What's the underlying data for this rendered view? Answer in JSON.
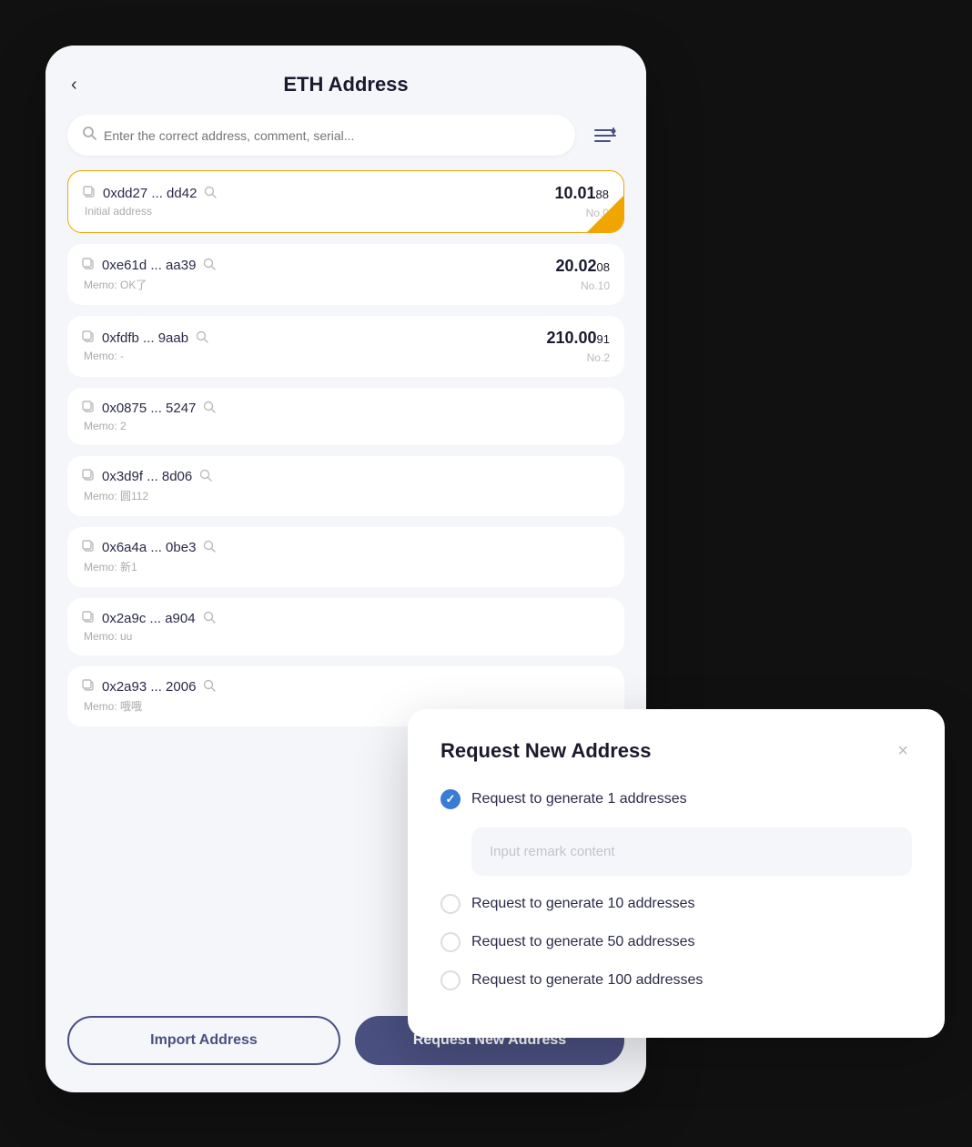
{
  "header": {
    "title": "ETH Address",
    "back_label": "‹"
  },
  "search": {
    "placeholder": "Enter the correct address, comment, serial..."
  },
  "addresses": [
    {
      "id": "addr-1",
      "address": "0xdd27 ... dd42",
      "memo": "Initial address",
      "balance_main": "10.01",
      "balance_decimal": "88",
      "no": "No.0",
      "active": true
    },
    {
      "id": "addr-2",
      "address": "0xe61d ... aa39",
      "memo": "Memo: OK了",
      "balance_main": "20.02",
      "balance_decimal": "08",
      "no": "No.10",
      "active": false
    },
    {
      "id": "addr-3",
      "address": "0xfdfb ... 9aab",
      "memo": "Memo: -",
      "balance_main": "210.00",
      "balance_decimal": "91",
      "no": "No.2",
      "active": false
    },
    {
      "id": "addr-4",
      "address": "0x0875 ... 5247",
      "memo": "Memo: 2",
      "balance_main": "",
      "balance_decimal": "",
      "no": "",
      "active": false
    },
    {
      "id": "addr-5",
      "address": "0x3d9f ... 8d06",
      "memo": "Memo: 圆112",
      "balance_main": "",
      "balance_decimal": "",
      "no": "",
      "active": false
    },
    {
      "id": "addr-6",
      "address": "0x6a4a ... 0be3",
      "memo": "Memo: 新1",
      "balance_main": "",
      "balance_decimal": "",
      "no": "",
      "active": false
    },
    {
      "id": "addr-7",
      "address": "0x2a9c ... a904",
      "memo": "Memo: uu",
      "balance_main": "",
      "balance_decimal": "",
      "no": "",
      "active": false
    },
    {
      "id": "addr-8",
      "address": "0x2a93 ... 2006",
      "memo": "Memo: 哦哦",
      "balance_main": "",
      "balance_decimal": "",
      "no": "",
      "active": false
    }
  ],
  "footer": {
    "import_label": "Import Address",
    "request_label": "Request New Address"
  },
  "modal": {
    "title": "Request New Address",
    "close_label": "×",
    "options": [
      {
        "id": "opt-1",
        "label": "Request to generate 1 addresses",
        "selected": true
      },
      {
        "id": "opt-10",
        "label": "Request to generate 10 addresses",
        "selected": false
      },
      {
        "id": "opt-50",
        "label": "Request to generate 50 addresses",
        "selected": false
      },
      {
        "id": "opt-100",
        "label": "Request to generate 100 addresses",
        "selected": false
      }
    ],
    "remark_placeholder": "Input remark content"
  },
  "colors": {
    "accent_orange": "#f0a500",
    "accent_blue": "#3a7bd5",
    "nav_dark": "#4a5080"
  }
}
